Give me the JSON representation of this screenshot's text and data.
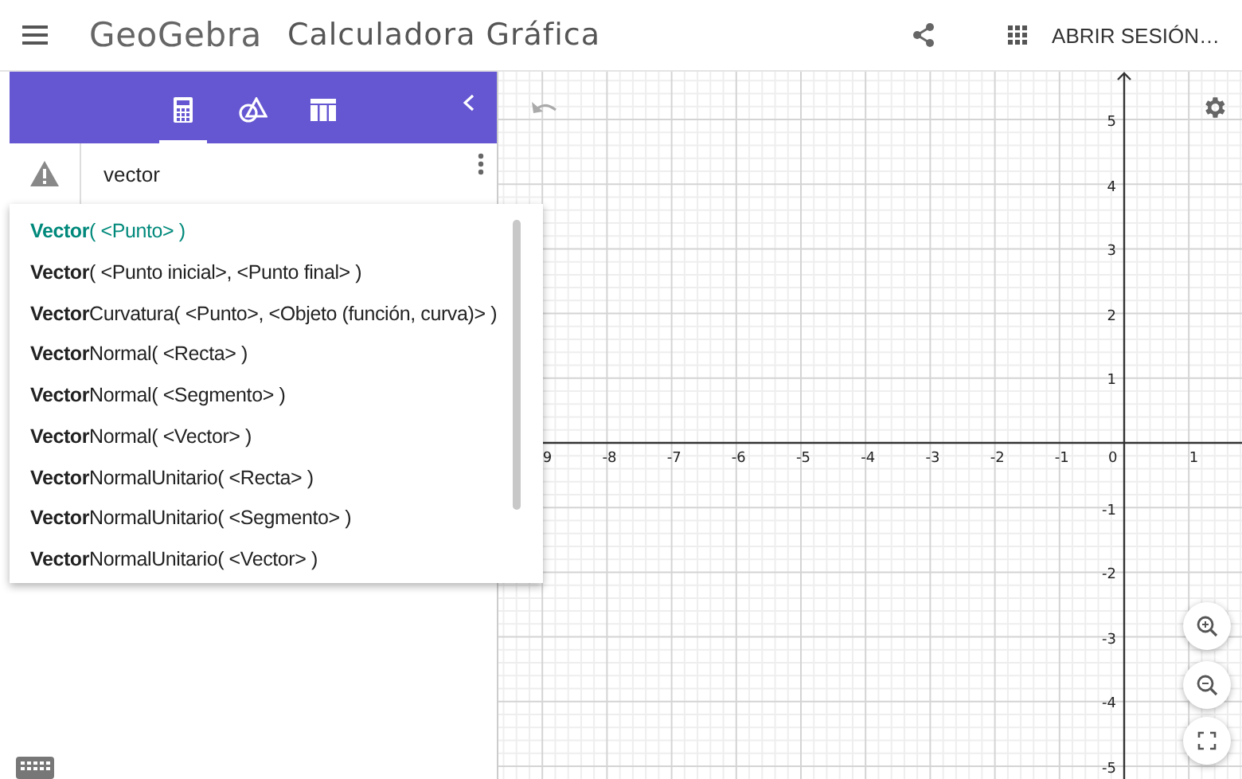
{
  "header": {
    "logo": "GeoGebra",
    "title": "Calculadora Gráfica",
    "sign_in": "ABRIR SESIÓN…"
  },
  "toolbar": {
    "tabs": [
      {
        "kind": "algebra",
        "selected": true
      },
      {
        "kind": "tools",
        "selected": false
      },
      {
        "kind": "table",
        "selected": false
      }
    ]
  },
  "algebra_input": {
    "value": "vector",
    "warning": true
  },
  "suggestions": [
    {
      "text": "**Vector**( <Punto> )",
      "selected": true
    },
    {
      "text": "**Vector**( <Punto inicial>, <Punto final> )",
      "selected": false
    },
    {
      "text": "**Vector**Curvatura( <Punto>, <Objeto (función, curva)> )",
      "selected": false
    },
    {
      "text": "**Vector**Normal( <Recta> )",
      "selected": false
    },
    {
      "text": "**Vector**Normal( <Segmento> )",
      "selected": false
    },
    {
      "text": "**Vector**Normal( <Vector> )",
      "selected": false
    },
    {
      "text": "**Vector**NormalUnitario( <Recta> )",
      "selected": false
    },
    {
      "text": "**Vector**NormalUnitario( <Segmento> )",
      "selected": false
    },
    {
      "text": "**Vector**NormalUnitario( <Vector> )",
      "selected": false
    }
  ],
  "graph": {
    "x_labels": [
      "9",
      "-8",
      "-7",
      "-6",
      "-5",
      "-4",
      "-3",
      "-2",
      "-1",
      "0",
      "1"
    ],
    "y_labels": [
      "5",
      "4",
      "3",
      "2",
      "1",
      "-1",
      "-2",
      "-3",
      "-4",
      "-5"
    ]
  }
}
